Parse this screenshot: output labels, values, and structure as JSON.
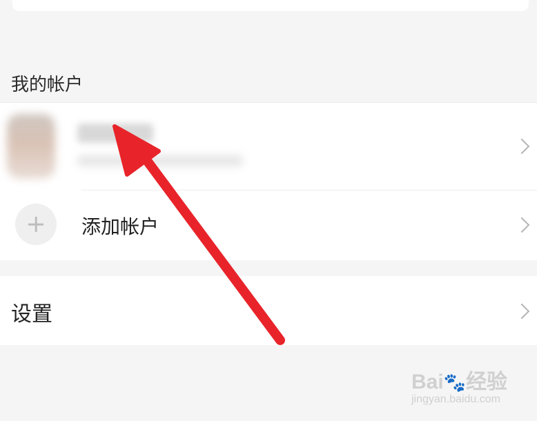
{
  "my_accounts": {
    "header": "我的帐户",
    "add_account_label": "添加帐户"
  },
  "settings": {
    "label": "设置"
  },
  "icons": {
    "add": "plus-icon",
    "chevron": "chevron-right-icon",
    "annotation": "red-arrow-annotation"
  },
  "colors": {
    "background": "#f5f5f5",
    "panel": "#ffffff",
    "annotation_arrow": "#e8242a"
  },
  "watermark": {
    "brand_pre": "Bai",
    "brand_paw": "🐾",
    "brand_post": "经验",
    "url": "jingyan.baidu.com"
  }
}
